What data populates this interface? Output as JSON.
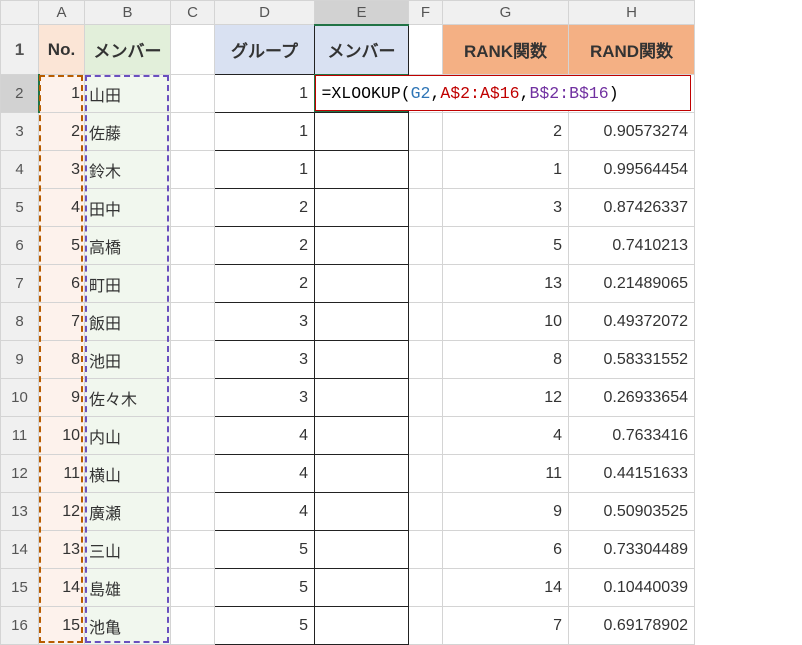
{
  "columns": [
    "A",
    "B",
    "C",
    "D",
    "E",
    "F",
    "G",
    "H"
  ],
  "header_row": {
    "A": "No.",
    "B": "メンバー",
    "D": "グループ",
    "E": "メンバー",
    "G": "RANK関数",
    "H": "RAND関数"
  },
  "formula": {
    "eq": "=",
    "fn": "XLOOKUP",
    "open": "(",
    "arg1": "G2",
    "c1": ",",
    "arg2": "A$2:A$16",
    "c2": ",",
    "arg3": "B$2:B$16",
    "close": ")"
  },
  "rows": [
    {
      "r": 2,
      "A": "1",
      "B": "山田",
      "D": "1",
      "G": "",
      "H": ""
    },
    {
      "r": 3,
      "A": "2",
      "B": "佐藤",
      "D": "1",
      "G": "2",
      "H": "0.90573274"
    },
    {
      "r": 4,
      "A": "3",
      "B": "鈴木",
      "D": "1",
      "G": "1",
      "H": "0.99564454"
    },
    {
      "r": 5,
      "A": "4",
      "B": "田中",
      "D": "2",
      "G": "3",
      "H": "0.87426337"
    },
    {
      "r": 6,
      "A": "5",
      "B": "高橋",
      "D": "2",
      "G": "5",
      "H": "0.7410213"
    },
    {
      "r": 7,
      "A": "6",
      "B": "町田",
      "D": "2",
      "G": "13",
      "H": "0.21489065"
    },
    {
      "r": 8,
      "A": "7",
      "B": "飯田",
      "D": "3",
      "G": "10",
      "H": "0.49372072"
    },
    {
      "r": 9,
      "A": "8",
      "B": "池田",
      "D": "3",
      "G": "8",
      "H": "0.58331552"
    },
    {
      "r": 10,
      "A": "9",
      "B": "佐々木",
      "D": "3",
      "G": "12",
      "H": "0.26933654"
    },
    {
      "r": 11,
      "A": "10",
      "B": "内山",
      "D": "4",
      "G": "4",
      "H": "0.7633416"
    },
    {
      "r": 12,
      "A": "11",
      "B": "横山",
      "D": "4",
      "G": "11",
      "H": "0.44151633"
    },
    {
      "r": 13,
      "A": "12",
      "B": "廣瀬",
      "D": "4",
      "G": "9",
      "H": "0.50903525"
    },
    {
      "r": 14,
      "A": "13",
      "B": "三山",
      "D": "5",
      "G": "6",
      "H": "0.73304489"
    },
    {
      "r": 15,
      "A": "14",
      "B": "島雄",
      "D": "5",
      "G": "14",
      "H": "0.10440039"
    },
    {
      "r": 16,
      "A": "15",
      "B": "池亀",
      "D": "5",
      "G": "7",
      "H": "0.69178902"
    }
  ],
  "chart_data": {
    "type": "table",
    "title": "",
    "data": {
      "No.": [
        1,
        2,
        3,
        4,
        5,
        6,
        7,
        8,
        9,
        10,
        11,
        12,
        13,
        14,
        15
      ],
      "メンバー": [
        "山田",
        "佐藤",
        "鈴木",
        "田中",
        "高橋",
        "町田",
        "飯田",
        "池田",
        "佐々木",
        "内山",
        "横山",
        "廣瀬",
        "三山",
        "島雄",
        "池亀"
      ],
      "グループ": [
        1,
        1,
        1,
        2,
        2,
        2,
        3,
        3,
        3,
        4,
        4,
        4,
        5,
        5,
        5
      ],
      "RANK関数": [
        null,
        2,
        1,
        3,
        5,
        13,
        10,
        8,
        12,
        4,
        11,
        9,
        6,
        14,
        7
      ],
      "RAND関数": [
        null,
        0.90573274,
        0.99564454,
        0.87426337,
        0.7410213,
        0.21489065,
        0.49372072,
        0.58331552,
        0.26933654,
        0.7633416,
        0.44151633,
        0.50903525,
        0.73304489,
        0.10440039,
        0.69178902
      ]
    },
    "formula_in_E2": "=XLOOKUP(G2,A$2:A$16,B$2:B$16)"
  },
  "colors": {
    "fillA": "#fbe5d6",
    "fillB": "#e2efda",
    "fillDE": "#d9e1f2",
    "fillGH": "#f4b084",
    "formula_border": "#c00000",
    "selection_green": "#217346"
  }
}
